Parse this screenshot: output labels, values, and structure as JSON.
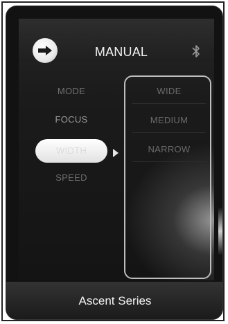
{
  "header": {
    "title": "MANUAL",
    "back_icon": "arrow-right-circle-icon",
    "status_icon": "bluetooth-icon"
  },
  "menu": {
    "items": [
      {
        "label": "MODE",
        "state": "normal"
      },
      {
        "label": "FOCUS",
        "state": "normal"
      },
      {
        "label": "WIDTH",
        "state": "selected"
      },
      {
        "label": "SPEED",
        "state": "normal"
      }
    ]
  },
  "options": {
    "items": [
      {
        "label": "WIDE"
      },
      {
        "label": "MEDIUM"
      },
      {
        "label": "NARROW"
      }
    ]
  },
  "footer": {
    "label": "Ascent Series"
  },
  "colors": {
    "background": "#121212",
    "text_dim": "#6f6f6f",
    "selected_pill": "#ffffff",
    "panel_border": "#bdbdbd"
  }
}
